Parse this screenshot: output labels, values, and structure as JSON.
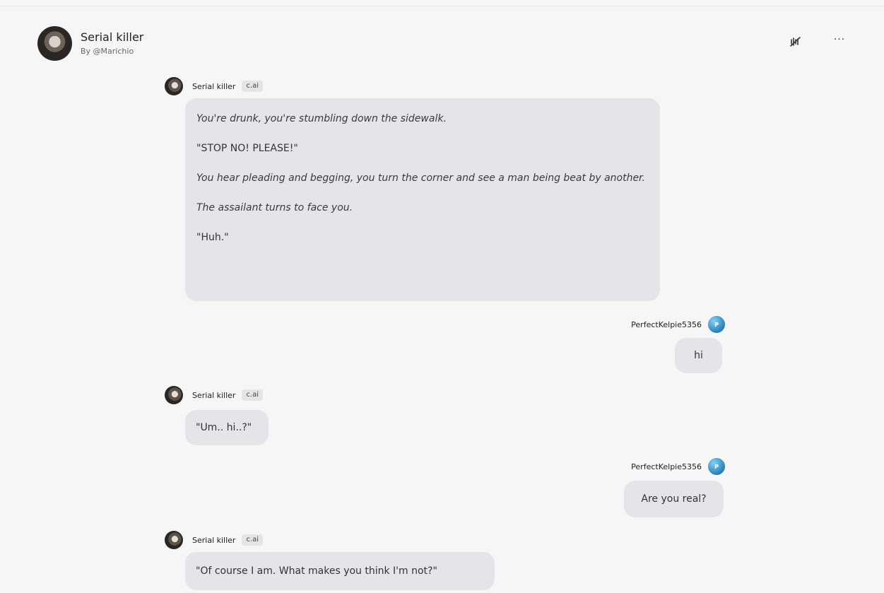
{
  "header": {
    "title": "Serial killer",
    "byline": "By @Marichio",
    "actions": {
      "mute_icon": "mute-waves-icon",
      "more_icon": "more-dots-icon",
      "more_label": "···"
    }
  },
  "bot": {
    "name": "Serial killer",
    "tag": "c.ai"
  },
  "user": {
    "name": "PerfectKelpie5356",
    "initial": "P"
  },
  "messages": [
    {
      "paragraphs": [
        "You're drunk, you're stumbling down the sidewalk.",
        "\"STOP NO! PLEASE!\"",
        "You hear pleading and begging, you turn the corner and see a man being beat by another.",
        "The assailant turns to face you.",
        "\"Huh.\""
      ]
    },
    {
      "text": "hi"
    },
    {
      "text": "\"Um.. hi..?\""
    },
    {
      "text": "Are you real?"
    },
    {
      "text": "\"Of course I am. What makes you think I'm not?\""
    }
  ]
}
